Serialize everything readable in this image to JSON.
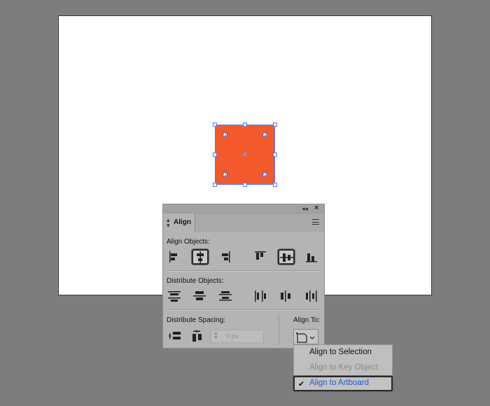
{
  "colors": {
    "background": "#7d7d7d",
    "shape_fill": "#f35a2b",
    "selection": "#4a7bf2",
    "accent_text": "#1a5fd6",
    "disabled_text": "#8a8a8a"
  },
  "panel": {
    "tab_label": "Align",
    "icons": {
      "collapse": "collapse-icon",
      "close": "close-icon",
      "menu": "panel-menu-icon"
    },
    "align_objects": {
      "label": "Align Objects:",
      "buttons": [
        {
          "name": "horizontal-align-left",
          "active": false
        },
        {
          "name": "horizontal-align-center",
          "active": true
        },
        {
          "name": "horizontal-align-right",
          "active": false
        },
        {
          "name": "vertical-align-top",
          "active": false
        },
        {
          "name": "vertical-align-center",
          "active": true
        },
        {
          "name": "vertical-align-bottom",
          "active": false
        }
      ]
    },
    "distribute_objects": {
      "label": "Distribute Objects:",
      "buttons": [
        {
          "name": "vertical-distribute-top"
        },
        {
          "name": "vertical-distribute-center"
        },
        {
          "name": "vertical-distribute-bottom"
        },
        {
          "name": "horizontal-distribute-left"
        },
        {
          "name": "horizontal-distribute-center"
        },
        {
          "name": "horizontal-distribute-right"
        }
      ]
    },
    "distribute_spacing": {
      "label": "Distribute Spacing:",
      "value": "0 px",
      "buttons": [
        {
          "name": "vertical-distribute-space"
        },
        {
          "name": "horizontal-distribute-space"
        }
      ]
    },
    "align_to": {
      "label": "Align To:",
      "icon": "align-to-artboard-icon"
    }
  },
  "dropdown": {
    "items": [
      {
        "label": "Align to Selection",
        "state": "normal"
      },
      {
        "label": "Align to Key Object",
        "state": "disabled"
      },
      {
        "label": "Align to Artboard",
        "state": "selected"
      }
    ],
    "check_glyph": "✔"
  }
}
